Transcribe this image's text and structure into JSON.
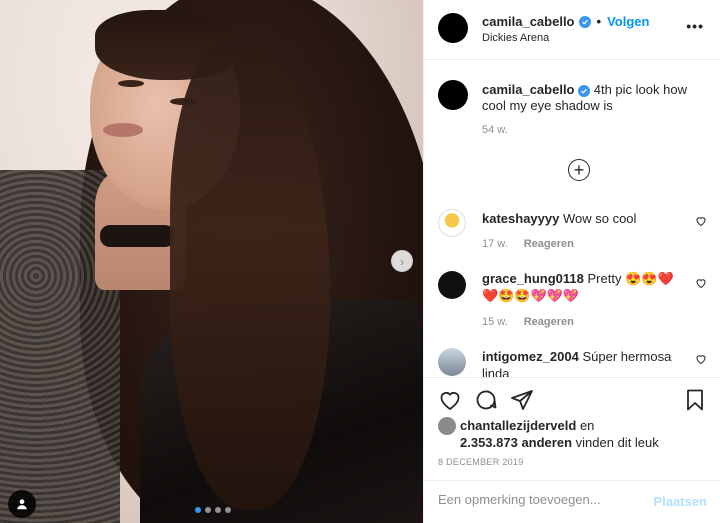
{
  "post": {
    "username": "camila_cabello",
    "follow_label": "Volgen",
    "separator": "•",
    "location": "Dickies Arena",
    "more_label": "•••"
  },
  "caption": {
    "username": "camila_cabello",
    "text": "4th pic look how cool my eye shadow is",
    "time": "54 w."
  },
  "comments": [
    {
      "username": "kateshayyyy",
      "text": "Wow so cool",
      "time": "17 w.",
      "reply_label": "Reageren"
    },
    {
      "username": "grace_hung0118",
      "text": "Pretty 😍😍❤️ ❤️🤩🤩💖💖💖",
      "time": "15 w.",
      "reply_label": "Reageren"
    },
    {
      "username": "intigomez_2004",
      "text": "Súper hermosa linda",
      "time": "",
      "reply_label": ""
    }
  ],
  "likes": {
    "liked_by": "chantallezijderveld",
    "connector": "en",
    "others_count": "2.353.873 anderen",
    "suffix": "vinden dit leuk"
  },
  "date": "8 DECEMBER 2019",
  "add_comment": {
    "placeholder": "Een opmerking toevoegen...",
    "post_label": "Plaatsen"
  },
  "carousel": {
    "slide_count": 4,
    "active_slide": 1
  },
  "colors": {
    "accent": "#0095f6",
    "verified": "#3897f0",
    "muted": "#8e8e8e",
    "post_disabled": "#b2dffc"
  },
  "icons": [
    "verified-icon",
    "more-icon",
    "plus-circle-icon",
    "heart-icon",
    "comment-icon",
    "share-icon",
    "bookmark-icon",
    "next-arrow-icon",
    "user-tag-icon"
  ]
}
